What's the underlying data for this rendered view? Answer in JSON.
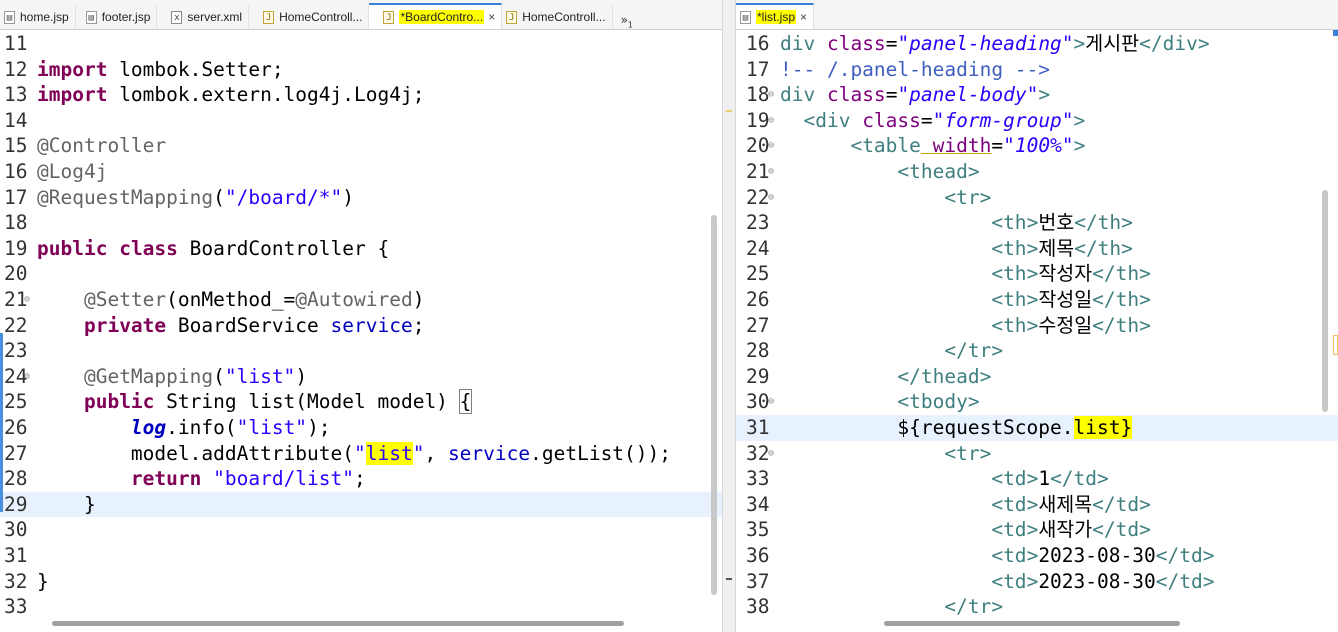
{
  "left_editor": {
    "tabs": [
      {
        "label": "home.jsp",
        "icon": "jsp-file-icon",
        "active": false
      },
      {
        "label": "footer.jsp",
        "icon": "jsp-file-icon",
        "active": false
      },
      {
        "label": "server.xml",
        "icon": "xml-file-icon",
        "active": false
      },
      {
        "label": "HomeControll...",
        "icon": "java-file-icon",
        "active": false
      },
      {
        "label": "*BoardContro...",
        "icon": "java-file-icon",
        "active": true
      },
      {
        "label": "HomeControll...",
        "icon": "java-file-icon",
        "active": false
      }
    ],
    "overflow_label": "»",
    "overflow_count": "1",
    "close_glyph": "×",
    "lines": [
      {
        "n": "11",
        "code": ""
      },
      {
        "n": "12",
        "code": "import lombok.Setter;"
      },
      {
        "n": "13",
        "code": "import lombok.extern.log4j.Log4j;"
      },
      {
        "n": "14",
        "code": ""
      },
      {
        "n": "15",
        "code": "@Controller"
      },
      {
        "n": "16",
        "code": "@Log4j"
      },
      {
        "n": "17",
        "code": "@RequestMapping(\"/board/*\")"
      },
      {
        "n": "18",
        "code": ""
      },
      {
        "n": "19",
        "code": "public class BoardController {"
      },
      {
        "n": "20",
        "code": ""
      },
      {
        "n": "21",
        "code": "    @Setter(onMethod_=@Autowired)"
      },
      {
        "n": "22",
        "code": "    private BoardService service;"
      },
      {
        "n": "23",
        "code": ""
      },
      {
        "n": "24",
        "code": "    @GetMapping(\"list\")"
      },
      {
        "n": "25",
        "code": "    public String list(Model model) {"
      },
      {
        "n": "26",
        "code": "        log.info(\"list\");"
      },
      {
        "n": "27",
        "code": "        model.addAttribute(\"list\", service.getList());"
      },
      {
        "n": "28",
        "code": "        return \"board/list\";"
      },
      {
        "n": "29",
        "code": "    }"
      },
      {
        "n": "30",
        "code": ""
      },
      {
        "n": "31",
        "code": ""
      },
      {
        "n": "32",
        "code": "}"
      },
      {
        "n": "33",
        "code": ""
      }
    ]
  },
  "right_editor": {
    "tabs": [
      {
        "label": "*list.jsp",
        "icon": "jsp-file-icon",
        "active": true
      }
    ],
    "close_glyph": "×",
    "lines": [
      {
        "n": "16",
        "code": "div class=\"panel-heading\">게시판</div>"
      },
      {
        "n": "17",
        "code": "!-- /.panel-heading -->"
      },
      {
        "n": "18",
        "code": "div class=\"panel-body\">"
      },
      {
        "n": "19",
        "code": "  <div class=\"form-group\">"
      },
      {
        "n": "20",
        "code": "      <table width=\"100%\">"
      },
      {
        "n": "21",
        "code": "          <thead>"
      },
      {
        "n": "22",
        "code": "              <tr>"
      },
      {
        "n": "23",
        "code": "                  <th>번호</th>"
      },
      {
        "n": "24",
        "code": "                  <th>제목</th>"
      },
      {
        "n": "25",
        "code": "                  <th>작성자</th>"
      },
      {
        "n": "26",
        "code": "                  <th>작성일</th>"
      },
      {
        "n": "27",
        "code": "                  <th>수정일</th>"
      },
      {
        "n": "28",
        "code": "              </tr>"
      },
      {
        "n": "29",
        "code": "          </thead>"
      },
      {
        "n": "30",
        "code": "          <tbody>"
      },
      {
        "n": "31",
        "code": "          ${requestScope.list}"
      },
      {
        "n": "32",
        "code": "              <tr>"
      },
      {
        "n": "33",
        "code": "                  <td>1</td>"
      },
      {
        "n": "34",
        "code": "                  <td>새제목</td>"
      },
      {
        "n": "35",
        "code": "                  <td>새작가</td>"
      },
      {
        "n": "36",
        "code": "                  <td>2023-08-30</td>"
      },
      {
        "n": "37",
        "code": "                  <td>2023-08-30</td>"
      },
      {
        "n": "38",
        "code": "              </tr>"
      }
    ]
  },
  "colors": {
    "keyword": "#7f0055",
    "annotation": "#646464",
    "string": "#2a00ff",
    "field": "#0000c0",
    "tag": "#3f7f7f",
    "attribute": "#7f007f",
    "current_line": "#e8f2fe",
    "highlight": "#ffff00"
  }
}
